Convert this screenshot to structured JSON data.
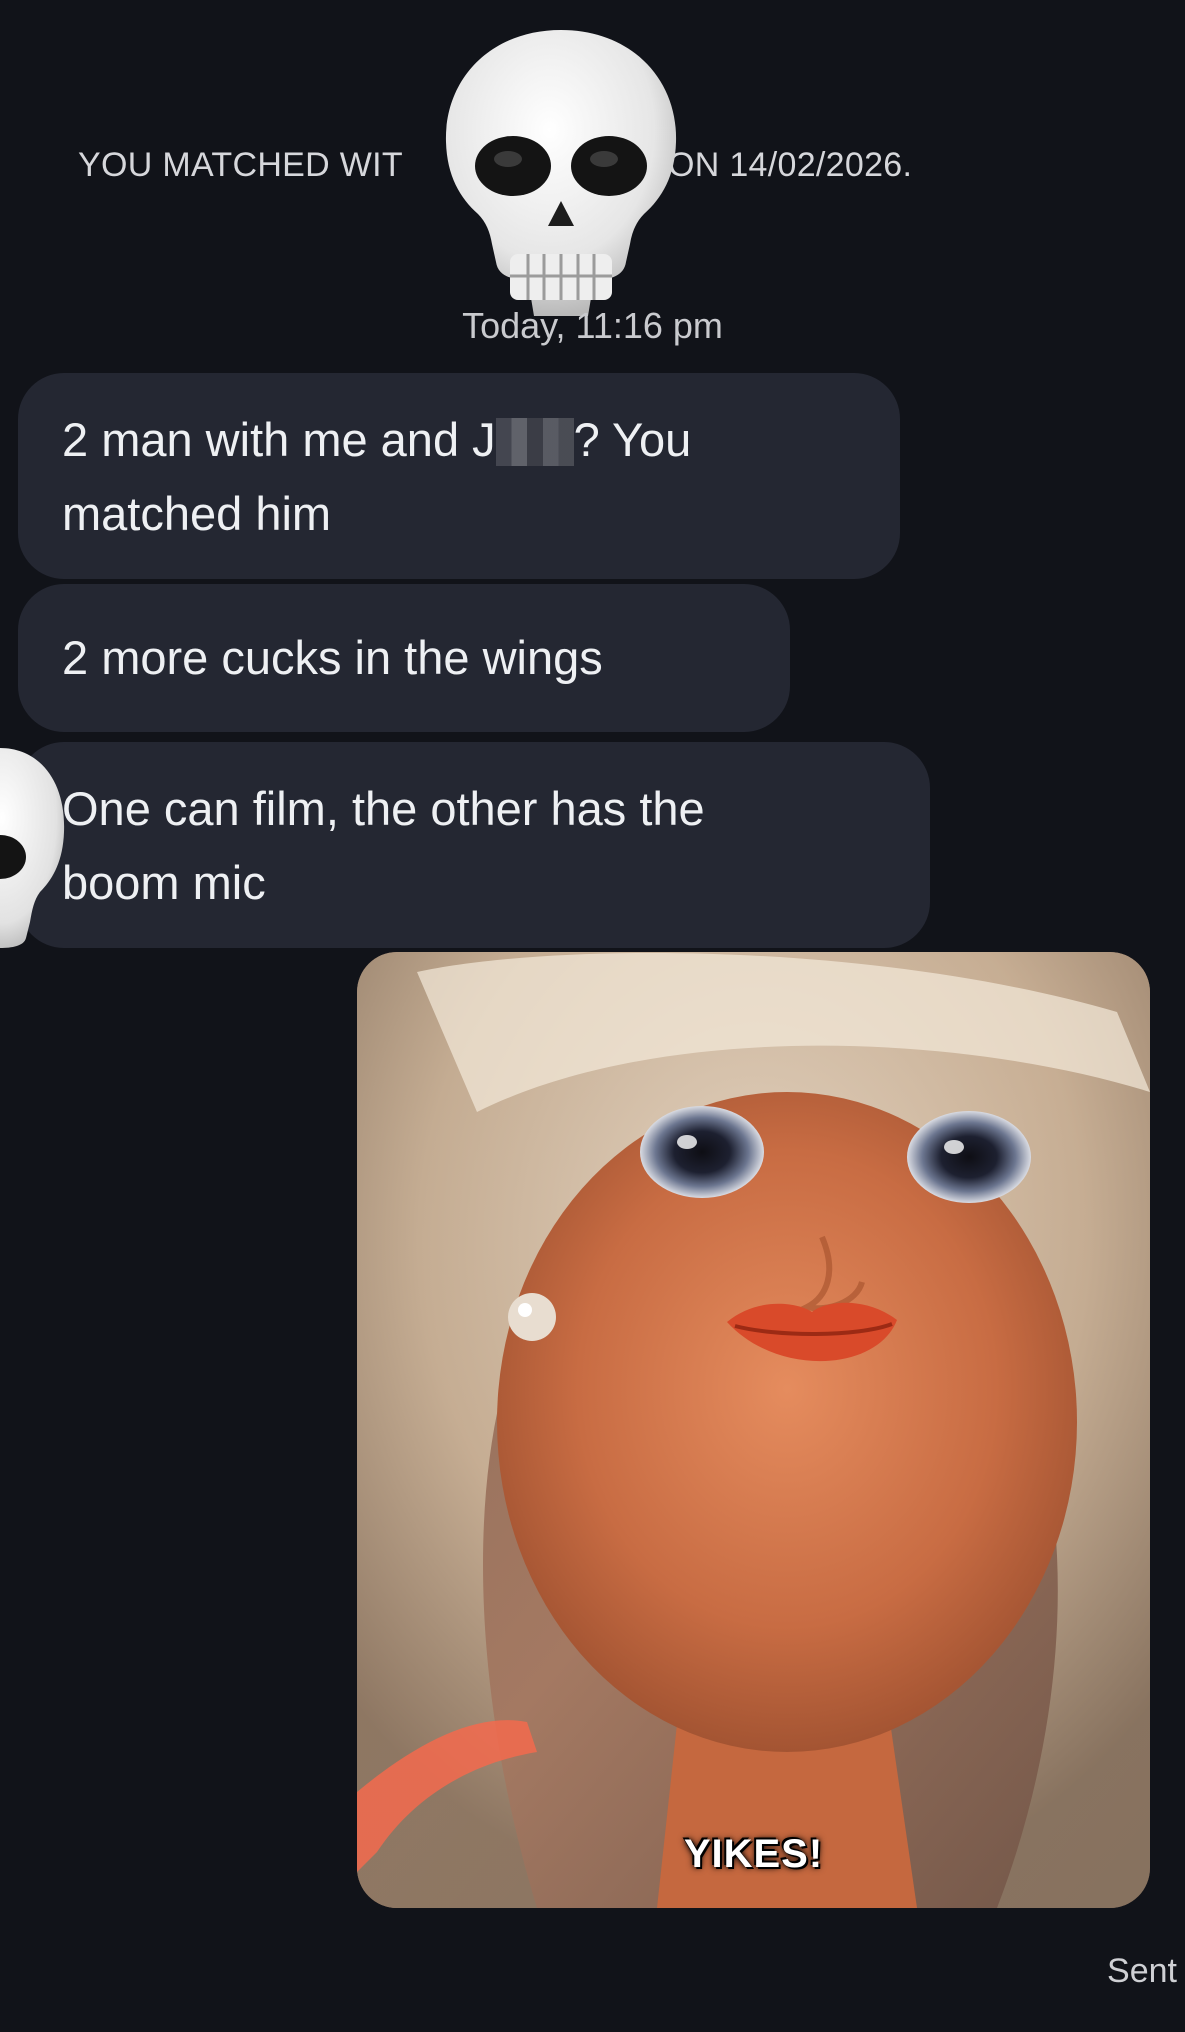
{
  "header": {
    "match_text_left": "YOU MATCHED WIT",
    "match_text_right": "ON 14/02/2026.",
    "timestamp": "Today, 11:16 pm"
  },
  "messages": [
    {
      "direction": "received",
      "lines": [
        "2 man with me and J",
        "? You",
        "matched him"
      ]
    },
    {
      "direction": "received",
      "lines": [
        "2 more cucks in the wings"
      ]
    },
    {
      "direction": "received",
      "lines": [
        "One can film, the other has the",
        "boom mic"
      ]
    },
    {
      "direction": "sent",
      "type": "gif",
      "caption": "YIKES!",
      "status": "Sent"
    }
  ],
  "stickers": [
    "skull-icon",
    "skull-icon"
  ],
  "colors": {
    "background": "#111319",
    "bubble_received": "#242732",
    "text": "#eef0f3"
  }
}
